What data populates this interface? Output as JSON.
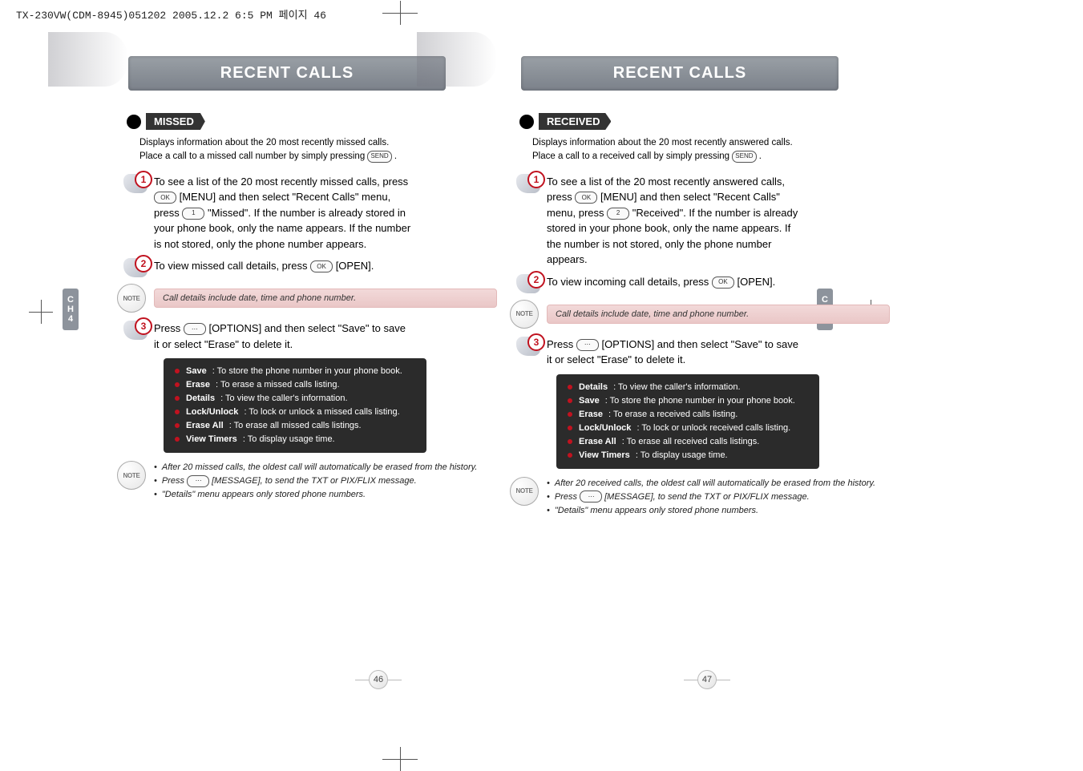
{
  "crop_header": "TX-230VW(CDM-8945)051202  2005.12.2 6:5 PM  페이지 46",
  "chapter_tab": {
    "label_top": "C",
    "label_mid": "H",
    "label_bot": "4"
  },
  "page_numbers": {
    "left": "46",
    "right": "47"
  },
  "left": {
    "banner": "RECENT CALLS",
    "section": "MISSED",
    "intro_line1": "Displays information about the 20 most recently missed calls.",
    "intro_line2_pre": "Place a call to a missed call number by simply pressing ",
    "intro_line2_key": "SEND",
    "intro_line2_post": " .",
    "step1_a": "To see a list of the 20 most recently missed calls, press ",
    "step1_key1": "OK",
    "step1_b": " [MENU] and then select \"Recent Calls\" menu, press ",
    "step1_key2": "1",
    "step1_c": " \"Missed\". If the number is already stored in your phone book, only the name appears. If the number is not stored, only the phone number appears.",
    "step2_a": "To view missed call details, press ",
    "step2_key": "OK",
    "step2_b": " [OPEN].",
    "note1": "Call details include date, time and phone number.",
    "step3_a": "Press ",
    "step3_key": "⋯",
    "step3_b": " [OPTIONS] and then select \"Save\" to save it or select \"Erase\" to delete it.",
    "options": [
      {
        "name": "Save",
        "desc": ": To store the phone number in your phone book."
      },
      {
        "name": "Erase",
        "desc": ": To erase a missed calls listing."
      },
      {
        "name": "Details",
        "desc": ": To view the caller's information."
      },
      {
        "name": "Lock/Unlock",
        "desc": ": To lock or unlock a missed calls listing."
      },
      {
        "name": "Erase All",
        "desc": ": To erase all missed calls listings."
      },
      {
        "name": "View Timers",
        "desc": ": To display usage time."
      }
    ],
    "note2": {
      "l1": "After 20 missed calls, the oldest call will automatically be erased from the history.",
      "l2_pre": "Press ",
      "l2_key": "⋯",
      "l2_post": " [MESSAGE], to send the TXT or PIX/FLIX message.",
      "l3": "\"Details\" menu appears only stored phone numbers."
    }
  },
  "right": {
    "banner": "RECENT CALLS",
    "section": "RECEIVED",
    "intro_line1": "Displays information about the 20 most recently answered calls.",
    "intro_line2_pre": "Place a call to a received call by simply pressing ",
    "intro_line2_key": "SEND",
    "intro_line2_post": " .",
    "step1_a": "To see a list of the 20 most recently answered calls, press ",
    "step1_key1": "OK",
    "step1_b": " [MENU] and then select \"Recent Calls\" menu, press ",
    "step1_key2": "2",
    "step1_c": " \"Received\". If the number is already stored in your phone book, only the name appears. If the number is not stored, only the phone number appears.",
    "step2_a": "To view incoming call details, press ",
    "step2_key": "OK",
    "step2_b": " [OPEN].",
    "note1": "Call details include date, time and phone number.",
    "step3_a": "Press ",
    "step3_key": "⋯",
    "step3_b": " [OPTIONS] and then select \"Save\" to save it or select \"Erase\" to delete it.",
    "options": [
      {
        "name": "Details",
        "desc": ": To view the caller's information."
      },
      {
        "name": "Save",
        "desc": ": To store the phone number in your phone book."
      },
      {
        "name": "Erase",
        "desc": ": To erase a received calls listing."
      },
      {
        "name": "Lock/Unlock",
        "desc": ": To lock or unlock received calls listing."
      },
      {
        "name": "Erase All",
        "desc": ": To erase all received calls listings."
      },
      {
        "name": "View Timers",
        "desc": ": To display usage time."
      }
    ],
    "note2": {
      "l1": "After 20 received calls, the oldest call will automatically be erased from the history.",
      "l2_pre": "Press ",
      "l2_key": "⋯",
      "l2_post": " [MESSAGE], to send the TXT or PIX/FLIX message.",
      "l3": "\"Details\" menu appears only stored phone numbers."
    }
  },
  "note_icon_label": "NOTE"
}
